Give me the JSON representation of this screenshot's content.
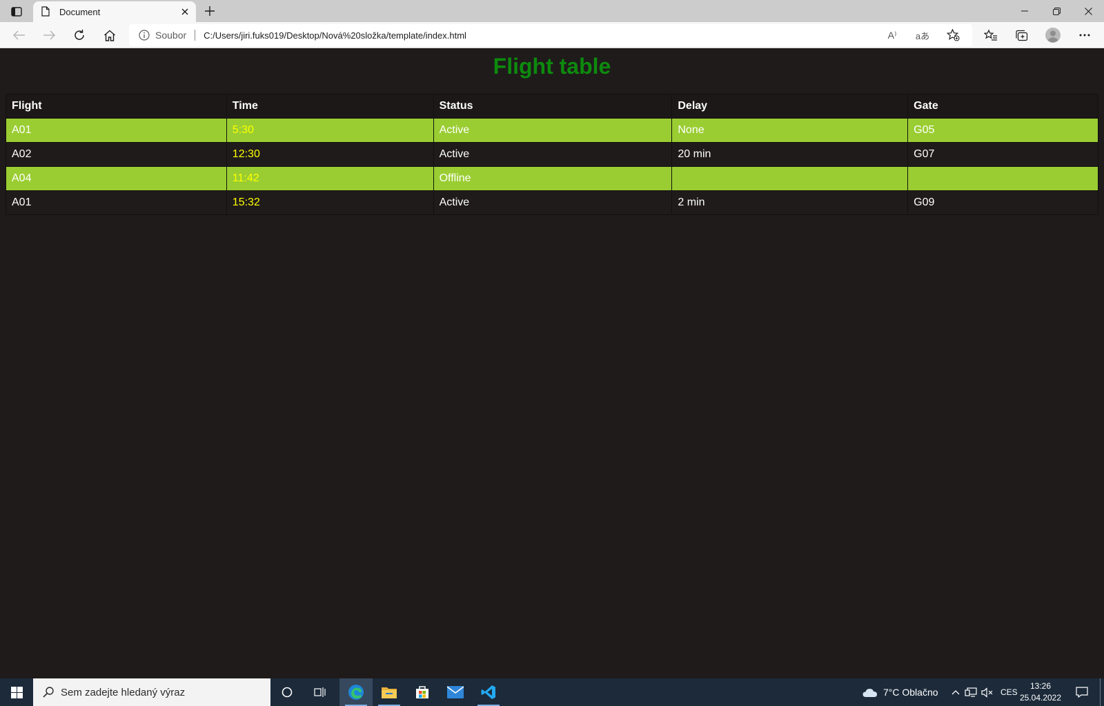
{
  "browser": {
    "tab_title": "Document",
    "address_label": "Soubor",
    "url": "C:/Users/jiri.fuks019/Desktop/Nová%20složka/template/index.html",
    "read_aloud_glyph": "A⁾",
    "translate_glyph": "aあ"
  },
  "page": {
    "title": "Flight table",
    "title_color": "#0d8a0d",
    "alt_row_color": "#9acd32",
    "time_color": "#ffff00",
    "table": {
      "headers": [
        "Flight",
        "Time",
        "Status",
        "Delay",
        "Gate"
      ],
      "rows": [
        [
          "A01",
          "5:30",
          "Active",
          "None",
          "G05"
        ],
        [
          "A02",
          "12:30",
          "Active",
          "20 min",
          "G07"
        ],
        [
          "A04",
          "11:42",
          "Offline",
          "",
          ""
        ],
        [
          "A01",
          "15:32",
          "Active",
          "2 min",
          "G09"
        ]
      ]
    }
  },
  "taskbar": {
    "search_placeholder": "Sem zadejte hledaný výraz",
    "weather": "7°C  Oblačno",
    "language": "CES",
    "time": "13:26",
    "date": "25.04.2022"
  }
}
